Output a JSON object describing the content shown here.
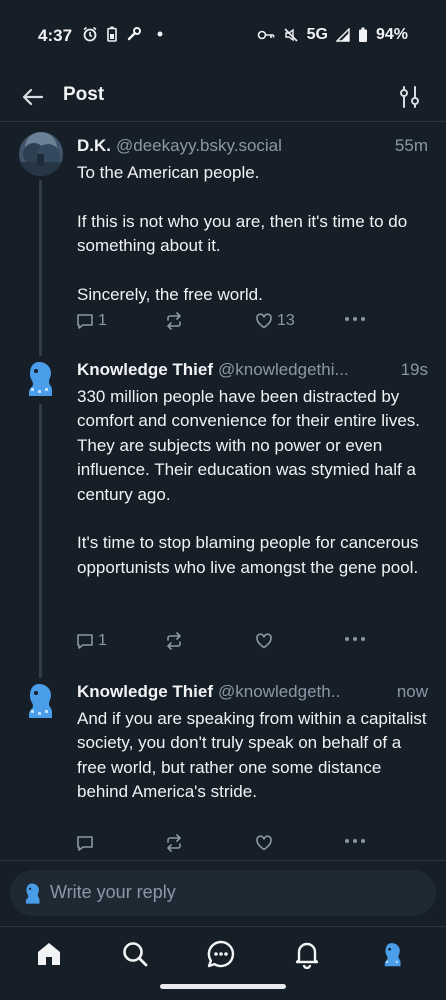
{
  "status_bar": {
    "time": "4:37",
    "network": "5G",
    "battery": "94%",
    "icons": [
      "alarm-icon",
      "battery-saver-icon",
      "wrench-icon",
      "dot-icon",
      "key-icon",
      "mute-icon",
      "signal-icon",
      "battery-icon"
    ]
  },
  "header": {
    "title": "Post",
    "back_icon": "arrow-left-icon",
    "filter_icon": "sliders-icon"
  },
  "posts": [
    {
      "name": "D.K.",
      "handle": "@deekayy.bsky.social",
      "time": "55m",
      "text": "To the American people.\n\nIf this is not who you are, then it's time to do something about it.\n\nSincerely, the free world.",
      "replies": "1",
      "reposts": "",
      "likes": "13"
    },
    {
      "name": "Knowledge Thief",
      "handle": "@knowledgethi...",
      "time": "19s",
      "text": "330 million people have been distracted by comfort and convenience for their entire lives. They are subjects with no power or even influence.  Their education was stymied half a century ago.\n\nIt's time to stop blaming people for cancerous opportunists who live amongst the gene pool.",
      "replies": "1",
      "reposts": "",
      "likes": ""
    },
    {
      "name": "Knowledge Thief",
      "handle": "@knowledgeth..",
      "time": "now",
      "text": "And if you are speaking from within a capitalist society, you don't truly speak on behalf of a free world, but rather one some distance behind America's stride.",
      "replies": "",
      "reposts": "",
      "likes": ""
    }
  ],
  "reply": {
    "placeholder": "Write your reply"
  },
  "bottom_nav": {
    "items": [
      "home-icon",
      "search-icon",
      "chat-icon",
      "bell-icon",
      "profile-avatar"
    ],
    "colors": {
      "background": "#161e27",
      "text": "#f1f3f5",
      "muted": "#8a98a6",
      "avatar_blue": "#4a9de8"
    }
  }
}
